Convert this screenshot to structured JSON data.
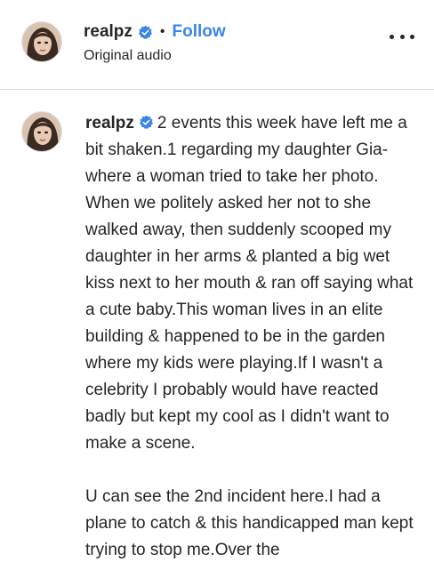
{
  "header": {
    "username": "realpz",
    "separator": "•",
    "follow_label": "Follow",
    "audio_label": "Original audio"
  },
  "caption": {
    "username": "realpz",
    "paragraph1": "2 events this week have left me a bit shaken.1 regarding my daughter Gia-where a woman tried to take her photo. When we politely asked her not to she walked away, then suddenly scooped my daughter in her arms & planted a big wet kiss next to her mouth & ran off saying what a cute baby.This woman lives in an elite building & happened to be in the garden where my kids were playing.If I wasn't a celebrity I probably would have reacted badly but kept my cool as I didn't want to make a scene.",
    "paragraph2": "U can see the 2nd incident here.I had a plane to catch & this handicapped man kept trying to stop me.Over the"
  },
  "colors": {
    "accent": "#3b84e8",
    "text": "#262626",
    "divider": "#dbdbdb"
  },
  "icons": {
    "verified": "verified-badge-icon",
    "more": "more-options-icon"
  }
}
